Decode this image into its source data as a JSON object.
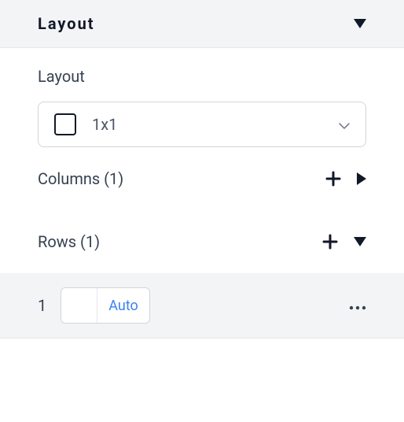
{
  "panel": {
    "title": "Layout"
  },
  "layoutSection": {
    "label": "Layout",
    "selectedValue": "1x1"
  },
  "columns": {
    "label": "Columns (1)"
  },
  "rows": {
    "label": "Rows (1)"
  },
  "rowItem": {
    "index": "1",
    "sizeLabel": "Auto"
  }
}
